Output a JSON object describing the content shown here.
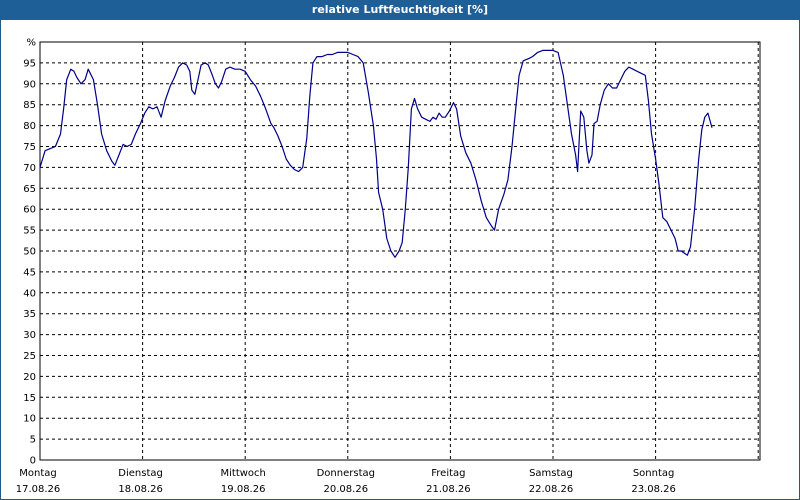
{
  "chart_data": {
    "type": "line",
    "title": "relative Luftfeuchtigkeit [%]",
    "y_unit_label": "%",
    "ylim": [
      0,
      100
    ],
    "y_ticks": [
      0,
      5,
      10,
      15,
      20,
      25,
      30,
      35,
      40,
      45,
      50,
      55,
      60,
      65,
      70,
      75,
      80,
      85,
      90,
      95
    ],
    "x_ticks": [
      {
        "day": "Montag",
        "date": "17.08.26"
      },
      {
        "day": "Dienstag",
        "date": "18.08.26"
      },
      {
        "day": "Mittwoch",
        "date": "19.08.26"
      },
      {
        "day": "Donnerstag",
        "date": "20.08.26"
      },
      {
        "day": "Freitag",
        "date": "21.08.26"
      },
      {
        "day": "Samstag",
        "date": "22.08.26"
      },
      {
        "day": "Sonntag",
        "date": "23.08.26"
      }
    ],
    "grid": true,
    "line_color": "#00008b",
    "series": [
      {
        "x_unit": "days since Montag 17.08.26 00:00",
        "points": [
          [
            0.0,
            70
          ],
          [
            0.05,
            74
          ],
          [
            0.1,
            74.5
          ],
          [
            0.15,
            75
          ],
          [
            0.2,
            78
          ],
          [
            0.23,
            84
          ],
          [
            0.26,
            91
          ],
          [
            0.3,
            93.5
          ],
          [
            0.33,
            93
          ],
          [
            0.36,
            91.5
          ],
          [
            0.4,
            90
          ],
          [
            0.44,
            91
          ],
          [
            0.47,
            93.5
          ],
          [
            0.52,
            91
          ],
          [
            0.56,
            85
          ],
          [
            0.6,
            78
          ],
          [
            0.65,
            74
          ],
          [
            0.7,
            71.5
          ],
          [
            0.73,
            70.5
          ],
          [
            0.77,
            73
          ],
          [
            0.81,
            75.5
          ],
          [
            0.85,
            75
          ],
          [
            0.89,
            75.5
          ],
          [
            0.93,
            78
          ],
          [
            0.98,
            80.5
          ],
          [
            1.02,
            83
          ],
          [
            1.06,
            84.5
          ],
          [
            1.1,
            84
          ],
          [
            1.14,
            84.5
          ],
          [
            1.18,
            82
          ],
          [
            1.22,
            86
          ],
          [
            1.27,
            89.5
          ],
          [
            1.31,
            91.5
          ],
          [
            1.35,
            94
          ],
          [
            1.39,
            95
          ],
          [
            1.43,
            94.5
          ],
          [
            1.46,
            93
          ],
          [
            1.48,
            88.5
          ],
          [
            1.51,
            87.5
          ],
          [
            1.54,
            91
          ],
          [
            1.57,
            94.5
          ],
          [
            1.61,
            95
          ],
          [
            1.64,
            94.5
          ],
          [
            1.68,
            92
          ],
          [
            1.71,
            90
          ],
          [
            1.74,
            89
          ],
          [
            1.77,
            90.5
          ],
          [
            1.81,
            93.5
          ],
          [
            1.85,
            94
          ],
          [
            1.9,
            93.5
          ],
          [
            1.95,
            93.5
          ],
          [
            2.0,
            93
          ],
          [
            2.05,
            91
          ],
          [
            2.1,
            89.5
          ],
          [
            2.15,
            87
          ],
          [
            2.2,
            84
          ],
          [
            2.25,
            80.5
          ],
          [
            2.28,
            79.5
          ],
          [
            2.32,
            77.5
          ],
          [
            2.36,
            75
          ],
          [
            2.4,
            72
          ],
          [
            2.44,
            70.5
          ],
          [
            2.48,
            69.5
          ],
          [
            2.52,
            69
          ],
          [
            2.56,
            70
          ],
          [
            2.6,
            77
          ],
          [
            2.63,
            87
          ],
          [
            2.66,
            95
          ],
          [
            2.7,
            96.5
          ],
          [
            2.75,
            96.5
          ],
          [
            2.8,
            97
          ],
          [
            2.85,
            97
          ],
          [
            2.9,
            97.5
          ],
          [
            2.95,
            97.5
          ],
          [
            3.0,
            97.5
          ],
          [
            3.05,
            97
          ],
          [
            3.1,
            96.5
          ],
          [
            3.15,
            95
          ],
          [
            3.2,
            88
          ],
          [
            3.25,
            80
          ],
          [
            3.28,
            72
          ],
          [
            3.3,
            64
          ],
          [
            3.34,
            60
          ],
          [
            3.38,
            53
          ],
          [
            3.42,
            50
          ],
          [
            3.46,
            48.5
          ],
          [
            3.5,
            50
          ],
          [
            3.53,
            52
          ],
          [
            3.56,
            60
          ],
          [
            3.59,
            70
          ],
          [
            3.62,
            84
          ],
          [
            3.65,
            86.5
          ],
          [
            3.68,
            84
          ],
          [
            3.72,
            82
          ],
          [
            3.76,
            81.5
          ],
          [
            3.8,
            81
          ],
          [
            3.83,
            82
          ],
          [
            3.86,
            81.5
          ],
          [
            3.89,
            83
          ],
          [
            3.92,
            82
          ],
          [
            3.95,
            82
          ],
          [
            3.99,
            83.5
          ],
          [
            4.03,
            85.5
          ],
          [
            4.06,
            84
          ],
          [
            4.1,
            77.5
          ],
          [
            4.15,
            73.5
          ],
          [
            4.2,
            71
          ],
          [
            4.25,
            67
          ],
          [
            4.3,
            62
          ],
          [
            4.35,
            58
          ],
          [
            4.4,
            56
          ],
          [
            4.43,
            55
          ],
          [
            4.47,
            60
          ],
          [
            4.52,
            63.5
          ],
          [
            4.56,
            67
          ],
          [
            4.6,
            75
          ],
          [
            4.64,
            85
          ],
          [
            4.67,
            92
          ],
          [
            4.71,
            95.5
          ],
          [
            4.76,
            96
          ],
          [
            4.8,
            96.5
          ],
          [
            4.85,
            97.5
          ],
          [
            4.9,
            98
          ],
          [
            4.95,
            98
          ],
          [
            5.0,
            98
          ],
          [
            5.05,
            97.5
          ],
          [
            5.1,
            92
          ],
          [
            5.14,
            85
          ],
          [
            5.18,
            78
          ],
          [
            5.22,
            73
          ],
          [
            5.24,
            69
          ],
          [
            5.27,
            83.5
          ],
          [
            5.3,
            82
          ],
          [
            5.33,
            74
          ],
          [
            5.35,
            71
          ],
          [
            5.38,
            73
          ],
          [
            5.4,
            80.5
          ],
          [
            5.43,
            81
          ],
          [
            5.46,
            85
          ],
          [
            5.5,
            88.5
          ],
          [
            5.54,
            90
          ],
          [
            5.58,
            89
          ],
          [
            5.62,
            89
          ],
          [
            5.66,
            91
          ],
          [
            5.7,
            93
          ],
          [
            5.74,
            94
          ],
          [
            5.78,
            93.5
          ],
          [
            5.82,
            93
          ],
          [
            5.86,
            92.5
          ],
          [
            5.9,
            92
          ],
          [
            5.93,
            86
          ],
          [
            5.96,
            78
          ],
          [
            6.0,
            72
          ],
          [
            6.03,
            66.5
          ],
          [
            6.07,
            58
          ],
          [
            6.11,
            57
          ],
          [
            6.15,
            55
          ],
          [
            6.19,
            53
          ],
          [
            6.22,
            50
          ],
          [
            6.25,
            50
          ],
          [
            6.28,
            49.5
          ],
          [
            6.31,
            49
          ],
          [
            6.34,
            51
          ],
          [
            6.38,
            60
          ],
          [
            6.42,
            72
          ],
          [
            6.45,
            79
          ],
          [
            6.48,
            82
          ],
          [
            6.51,
            83
          ],
          [
            6.55,
            79.5
          ]
        ]
      }
    ]
  }
}
